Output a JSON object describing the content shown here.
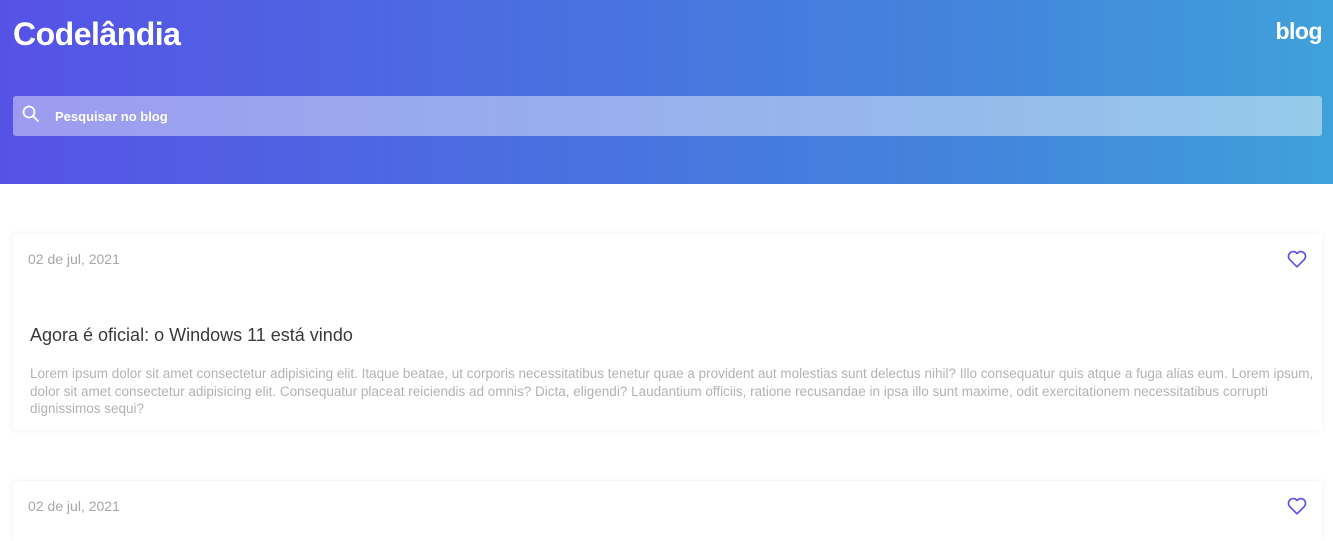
{
  "header": {
    "brand": "Codelândia",
    "nav_link": "blog",
    "search_placeholder": "Pesquisar no blog"
  },
  "colors": {
    "accent": "#5a4ff0",
    "gradient_start": "#5652e6",
    "gradient_end": "#3fa1da"
  },
  "icons": {
    "search": "search-icon",
    "like": "heart-outline-icon"
  },
  "posts": [
    {
      "date": "02 de jul, 2021",
      "title": "Agora é oficial: o Windows 11 está vindo",
      "excerpt": "Lorem ipsum dolor sit amet consectetur adipisicing elit. Itaque beatae, ut corporis necessitatibus tenetur quae a provident aut molestias sunt delectus nihil? Illo consequatur quis atque a fuga alias eum. Lorem ipsum, dolor sit amet consectetur adipisicing elit. Consequatur placeat reiciendis ad omnis? Dicta, eligendi? Laudantium officiis, ratione recusandae in ipsa illo sunt maxime, odit exercitationem necessitatibus corrupti dignissimos sequi?"
    },
    {
      "date": "02 de jul, 2021"
    }
  ]
}
